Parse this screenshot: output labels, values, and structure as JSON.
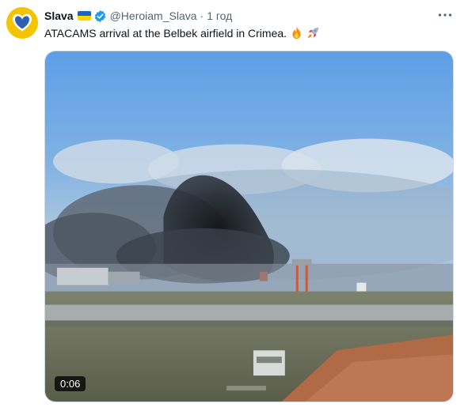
{
  "author": {
    "name": "Slava",
    "handle": "@Heroiam_Slava",
    "separator": "·",
    "time": "1 год",
    "avatar_color": "#f4c400",
    "flag_colors": [
      "#1a63c7",
      "#ffd500"
    ],
    "verified_color": "#1d9bf0"
  },
  "tweet": {
    "text": "ATACAMS arrival at the Belbek airfield in Crimea.",
    "emojis": [
      "fire-emoji",
      "rocket-emoji"
    ]
  },
  "media": {
    "type": "video",
    "duration": "0:06"
  },
  "icons": {
    "more": "more-horizontal-icon",
    "verified": "verified-badge-icon"
  }
}
